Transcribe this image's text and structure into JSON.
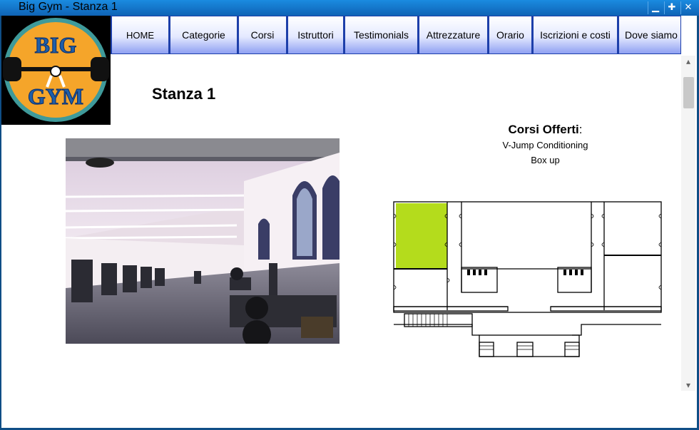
{
  "window": {
    "title": "Big Gym - Stanza 1",
    "minimize_glyph": "▁",
    "maximize_glyph": "✚",
    "close_glyph": "✕"
  },
  "logo": {
    "text_top": "BIG",
    "text_bottom": "GYM"
  },
  "nav": {
    "items": [
      "HOME",
      "Categorie",
      "Corsi",
      "Istruttori",
      "Testimonials",
      "Attrezzature",
      "Orario",
      "Iscrizioni e costi",
      "Dove siamo"
    ]
  },
  "page": {
    "title": "Stanza 1"
  },
  "courses": {
    "heading": "Corsi Offerti",
    "heading_suffix": ":",
    "items": [
      "V-Jump Conditioning",
      "Box up"
    ]
  },
  "colors": {
    "titlebar": "#1a7fd4",
    "nav_border": "#1d3faa",
    "room_highlight": "#b4dc1c",
    "logo_orange": "#f5a52a",
    "logo_ring": "#3f9a9a"
  },
  "scrollbar": {
    "up_glyph": "▴",
    "down_glyph": "▾"
  }
}
